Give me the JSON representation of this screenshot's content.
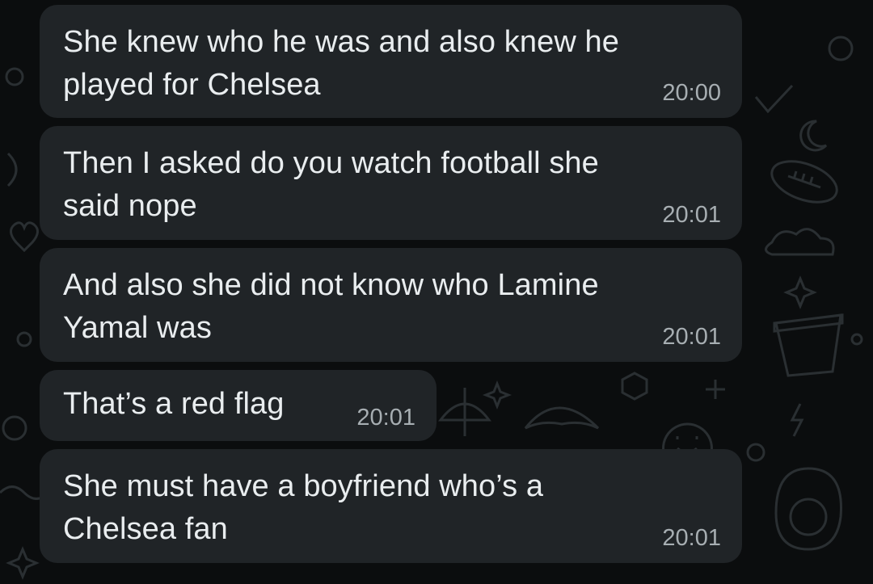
{
  "messages": [
    {
      "text": "She knew who he was and also knew he\nplayed for Chelsea",
      "time": "20:00"
    },
    {
      "text": "Then I asked do you watch football she\nsaid nope",
      "time": "20:01"
    },
    {
      "text": "And also she did not know who Lamine\nYamal was",
      "time": "20:01"
    },
    {
      "text": "That’s a red flag",
      "time": "20:01"
    },
    {
      "text": "She must have a boyfriend who’s a\nChelsea fan",
      "time": "20:01"
    }
  ]
}
